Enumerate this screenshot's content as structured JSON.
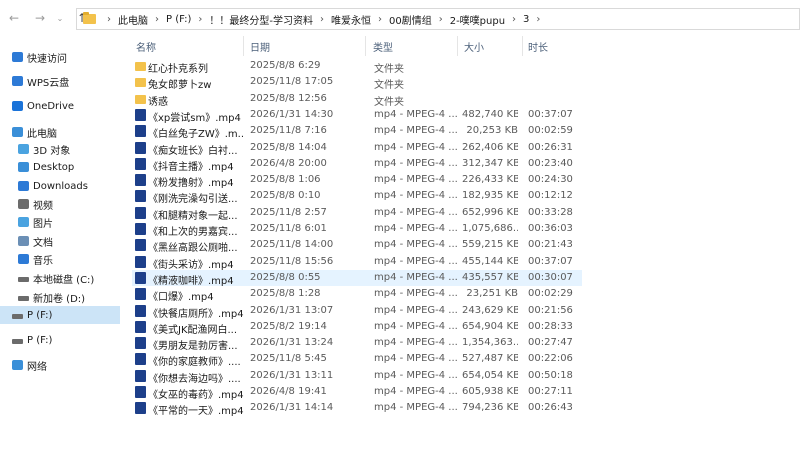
{
  "breadcrumb": [
    "此电脑",
    "P (F:)",
    "！！最终分型-学习资料",
    "唯爱永恒",
    "00剧情组",
    "2-噗噗pupu",
    "3"
  ],
  "columns": {
    "name": "名称",
    "date": "日期",
    "type": "类型",
    "size": "大小",
    "duration": "时长"
  },
  "sidebar": [
    {
      "label": "快速访问",
      "icon": "star-icon",
      "color": "#2d7ad6"
    },
    {
      "label": "WPS云盘",
      "icon": "cloud-icon",
      "color": "#2d7ad6"
    },
    {
      "label": "OneDrive",
      "icon": "onedrive-icon",
      "color": "#1a73d9"
    },
    {
      "label": "此电脑",
      "icon": "computer-icon",
      "color": "#3a8fd8"
    },
    {
      "label": "3D 对象",
      "icon": "3d-objects-icon",
      "color": "#4aa3e0"
    },
    {
      "label": "Desktop",
      "icon": "desktop-icon",
      "color": "#3a8fd8"
    },
    {
      "label": "Downloads",
      "icon": "download-icon",
      "color": "#2d7ad6"
    },
    {
      "label": "视频",
      "icon": "video-icon",
      "color": "#6b6b6b"
    },
    {
      "label": "图片",
      "icon": "pictures-icon",
      "color": "#4aa3e0"
    },
    {
      "label": "文档",
      "icon": "documents-icon",
      "color": "#6b8fb5"
    },
    {
      "label": "音乐",
      "icon": "music-icon",
      "color": "#2d7ad6"
    },
    {
      "label": "本地磁盘 (C:)",
      "icon": "drive-icon",
      "color": "#6b6b6b"
    },
    {
      "label": "新加卷 (D:)",
      "icon": "drive-icon",
      "color": "#6b6b6b"
    },
    {
      "label": "P (F:)",
      "icon": "drive-icon",
      "color": "#6b6b6b",
      "selected": true
    },
    {
      "label": "P (F:)",
      "icon": "drive-icon",
      "color": "#6b6b6b"
    },
    {
      "label": "网络",
      "icon": "network-icon",
      "color": "#3a8fd8"
    }
  ],
  "files": [
    {
      "name": "红心扑克系列",
      "date": "2025/8/8 6:29",
      "type": "文件夹",
      "size": "",
      "duration": "",
      "kind": "folder"
    },
    {
      "name": "兔女郎萝卜zw",
      "date": "2025/11/8 17:05",
      "type": "文件夹",
      "size": "",
      "duration": "",
      "kind": "folder"
    },
    {
      "name": "诱惑",
      "date": "2025/8/8 12:56",
      "type": "文件夹",
      "size": "",
      "duration": "",
      "kind": "folder"
    },
    {
      "name": "《xp尝试sm》.mp4",
      "date": "2026/1/31 14:30",
      "type": "mp4 - MPEG-4 ...",
      "size": "482,740 KB",
      "duration": "00:37:07",
      "kind": "video"
    },
    {
      "name": "《白丝兔子ZW》.m...",
      "date": "2025/11/8 7:16",
      "type": "mp4 - MPEG-4 ...",
      "size": "20,253 KB",
      "duration": "00:02:59",
      "kind": "video"
    },
    {
      "name": "《痴女班长》白衬...",
      "date": "2025/8/8 14:04",
      "type": "mp4 - MPEG-4 ...",
      "size": "262,406 KB",
      "duration": "00:26:31",
      "kind": "video"
    },
    {
      "name": "《抖音主播》.mp4",
      "date": "2026/4/8 20:00",
      "type": "mp4 - MPEG-4 ...",
      "size": "312,347 KB",
      "duration": "00:23:40",
      "kind": "video"
    },
    {
      "name": "《粉发撸射》.mp4",
      "date": "2025/8/8 1:06",
      "type": "mp4 - MPEG-4 ...",
      "size": "226,433 KB",
      "duration": "00:24:30",
      "kind": "video"
    },
    {
      "name": "《刚洗完澡勾引送...",
      "date": "2025/8/8 0:10",
      "type": "mp4 - MPEG-4 ...",
      "size": "182,935 KB",
      "duration": "00:12:12",
      "kind": "video"
    },
    {
      "name": "《和腿精对象一起...",
      "date": "2025/11/8 2:57",
      "type": "mp4 - MPEG-4 ...",
      "size": "652,996 KB",
      "duration": "00:33:28",
      "kind": "video"
    },
    {
      "name": "《和上次的男嘉宾...",
      "date": "2025/11/8 6:01",
      "type": "mp4 - MPEG-4 ...",
      "size": "1,075,686...",
      "duration": "00:36:03",
      "kind": "video"
    },
    {
      "name": "《黑丝高跟公厕啪...",
      "date": "2025/11/8 14:00",
      "type": "mp4 - MPEG-4 ...",
      "size": "559,215 KB",
      "duration": "00:21:43",
      "kind": "video"
    },
    {
      "name": "《街头采访》.mp4",
      "date": "2025/11/8 15:56",
      "type": "mp4 - MPEG-4 ...",
      "size": "455,144 KB",
      "duration": "00:37:07",
      "kind": "video"
    },
    {
      "name": "《精液咖啡》.mp4",
      "date": "2025/8/8 0:55",
      "type": "mp4 - MPEG-4 ...",
      "size": "435,557 KB",
      "duration": "00:30:07",
      "kind": "video",
      "hover": true
    },
    {
      "name": "《口爆》.mp4",
      "date": "2025/8/8 1:28",
      "type": "mp4 - MPEG-4 ...",
      "size": "23,251 KB",
      "duration": "00:02:29",
      "kind": "video"
    },
    {
      "name": "《快餐店厕所》.mp4",
      "date": "2026/1/31 13:07",
      "type": "mp4 - MPEG-4 ...",
      "size": "243,629 KB",
      "duration": "00:21:56",
      "kind": "video"
    },
    {
      "name": "《美式JK配渔网白...",
      "date": "2025/8/2 19:14",
      "type": "mp4 - MPEG-4 ...",
      "size": "654,904 KB",
      "duration": "00:28:33",
      "kind": "video"
    },
    {
      "name": "《男朋友是勃厉害...",
      "date": "2026/1/31 13:24",
      "type": "mp4 - MPEG-4 ...",
      "size": "1,354,363...",
      "duration": "00:27:47",
      "kind": "video"
    },
    {
      "name": "《你的家庭教师》....",
      "date": "2025/11/8 5:45",
      "type": "mp4 - MPEG-4 ...",
      "size": "527,487 KB",
      "duration": "00:22:06",
      "kind": "video"
    },
    {
      "name": "《你想去海边吗》....",
      "date": "2026/1/31 13:11",
      "type": "mp4 - MPEG-4 ...",
      "size": "654,054 KB",
      "duration": "00:50:18",
      "kind": "video"
    },
    {
      "name": "《女巫的毒药》.mp4",
      "date": "2026/4/8 19:41",
      "type": "mp4 - MPEG-4 ...",
      "size": "605,938 KB",
      "duration": "00:27:11",
      "kind": "video"
    },
    {
      "name": "《平常的一天》.mp4",
      "date": "2026/1/31 14:14",
      "type": "mp4 - MPEG-4 ...",
      "size": "794,236 KB",
      "duration": "00:26:43",
      "kind": "video"
    }
  ],
  "icons": {
    "back": "back-arrow-icon",
    "forward": "forward-arrow-icon",
    "recent": "recent-dropdown-icon",
    "up": "up-arrow-icon"
  },
  "colors": {
    "accent": "#cce4f7",
    "hover": "#e5f3ff",
    "folder": "#f3c24b",
    "video": "#1d3f8a"
  }
}
